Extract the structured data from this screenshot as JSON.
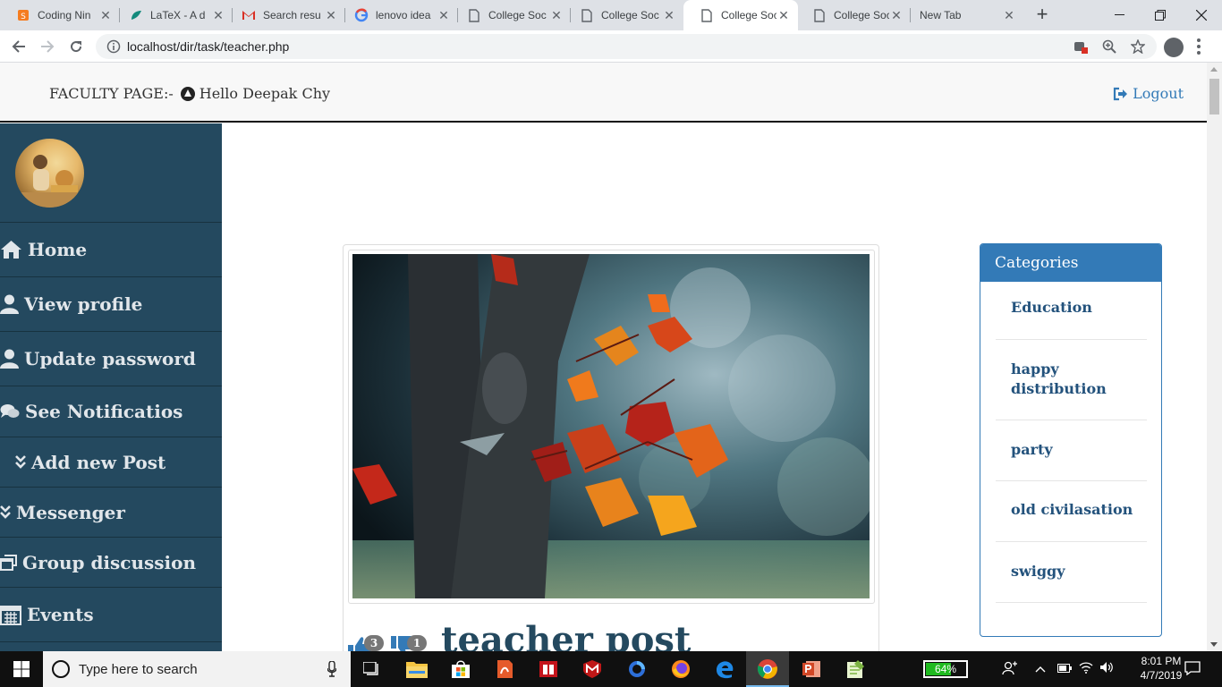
{
  "browser": {
    "tabs": [
      {
        "title": "Coding Nin",
        "icon": "coding-ninjas-icon"
      },
      {
        "title": "LaTeX - A d",
        "icon": "overleaf-icon"
      },
      {
        "title": "Search resu",
        "icon": "gmail-icon"
      },
      {
        "title": "lenovo idea",
        "icon": "google-icon"
      },
      {
        "title": "College Soc",
        "icon": "page-icon"
      },
      {
        "title": "College Soc",
        "icon": "page-icon"
      },
      {
        "title": "College Soc",
        "icon": "page-icon",
        "active": true
      },
      {
        "title": "College Soc",
        "icon": "page-icon"
      },
      {
        "title": "New Tab",
        "icon": ""
      }
    ],
    "url": "localhost/dir/task/teacher.php"
  },
  "navbar": {
    "faculty_label": "FACULTY PAGE:-",
    "greeting": "Hello Deepak Chy",
    "logout_label": "Logout"
  },
  "sidebar": {
    "items": [
      {
        "label": "Home",
        "icon": "home-icon"
      },
      {
        "label": "View profile",
        "icon": "user-icon"
      },
      {
        "label": "Update password",
        "icon": "user-icon"
      },
      {
        "label": "See Notificatios",
        "icon": "comments-icon"
      },
      {
        "label": "Add new Post",
        "icon": "double-chevron-down-icon"
      },
      {
        "label": "Messenger",
        "icon": "double-chevron-down-icon"
      },
      {
        "label": "Group discussion",
        "icon": "window-restore-icon"
      },
      {
        "label": "Events",
        "icon": "calendar-icon"
      }
    ]
  },
  "post": {
    "likes": "3",
    "dislikes": "1",
    "title": "teacher post"
  },
  "categories": {
    "heading": "Categories",
    "items": [
      "Education",
      "happy distribution",
      "party",
      "old civilasation",
      "swiggy"
    ]
  },
  "taskbar": {
    "search_placeholder": "Type here to search",
    "battery": "64%",
    "battery_level": 0.64,
    "time": "8:01 PM",
    "date": "4/7/2019"
  },
  "colors": {
    "sidebar_bg": "#24495f",
    "accent": "#337ab7",
    "link": "#23527c"
  }
}
